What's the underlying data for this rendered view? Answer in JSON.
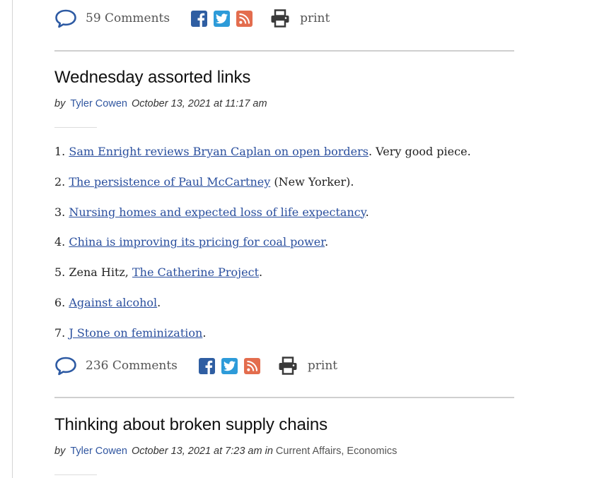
{
  "share_top": {
    "comments": "59 Comments",
    "print": "print"
  },
  "post1": {
    "title": "Wednesday assorted links",
    "by": "by",
    "author": "Tyler Cowen",
    "date": "October 13, 2021 at 11:17 am",
    "items": [
      {
        "num": "1.",
        "pre": "",
        "link": "Sam Enright reviews Bryan Caplan on open borders",
        "post": ".  Very good piece."
      },
      {
        "num": "2.",
        "pre": "",
        "link": "The persistence of Paul McCartney",
        "post": " (New Yorker)."
      },
      {
        "num": "3.",
        "pre": "",
        "link": "Nursing homes and expected loss of life expectancy",
        "post": "."
      },
      {
        "num": "4.",
        "pre": "",
        "link": "China is improving its pricing for coal power",
        "post": "."
      },
      {
        "num": "5.",
        "pre": "Zena Hitz, ",
        "link": "The Catherine Project",
        "post": "."
      },
      {
        "num": "6.",
        "pre": "",
        "link": "Against alcohol",
        "post": "."
      },
      {
        "num": "7.",
        "pre": "",
        "link": "J Stone on feminization",
        "post": "."
      }
    ]
  },
  "share_bottom": {
    "comments": "236 Comments",
    "print": "print"
  },
  "post2": {
    "title": "Thinking about broken supply chains",
    "by": "by",
    "author": "Tyler Cowen",
    "date": "October 13, 2021 at 7:23 am in",
    "categories": [
      "Current Affairs",
      "Economics"
    ],
    "separator": ","
  },
  "colors": {
    "link": "#2a4f9e",
    "author": "#3056a0",
    "facebook": "#2f5ea2",
    "twitter": "#2d9bd9",
    "rss": "#e36d4e"
  }
}
